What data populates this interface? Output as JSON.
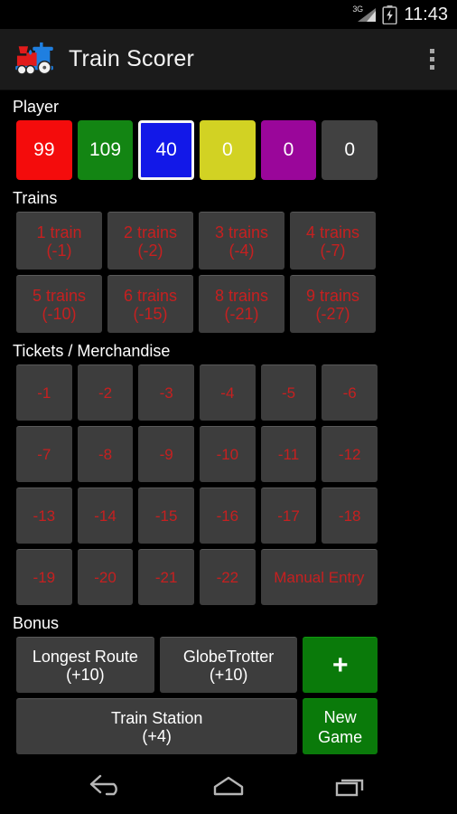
{
  "status_bar": {
    "network_label": "3G",
    "signal_icon": "signal-3g-icon",
    "battery_icon": "battery-charging-icon",
    "time": "11:43"
  },
  "action_bar": {
    "app_icon": "train-logo-icon",
    "title": "Train Scorer",
    "overflow_icon": "overflow-menu-icon"
  },
  "sections": {
    "player": {
      "label": "Player",
      "players": [
        {
          "score": "99",
          "color": "#f40c0c",
          "selected": false
        },
        {
          "score": "109",
          "color": "#138513",
          "selected": false
        },
        {
          "score": "40",
          "color": "#1218e8",
          "selected": true
        },
        {
          "score": "0",
          "color": "#d2d223",
          "selected": false
        },
        {
          "score": "0",
          "color": "#9a069a",
          "selected": false
        },
        {
          "score": "0",
          "color": "#414141",
          "selected": false
        }
      ]
    },
    "trains": {
      "label": "Trains",
      "buttons": [
        {
          "name": "1 train",
          "points": "(-1)"
        },
        {
          "name": "2 trains",
          "points": "(-2)"
        },
        {
          "name": "3 trains",
          "points": "(-4)"
        },
        {
          "name": "4 trains",
          "points": "(-7)"
        },
        {
          "name": "5 trains",
          "points": "(-10)"
        },
        {
          "name": "6 trains",
          "points": "(-15)"
        },
        {
          "name": "8 trains",
          "points": "(-21)"
        },
        {
          "name": "9 trains",
          "points": "(-27)"
        }
      ]
    },
    "tickets": {
      "label": "Tickets / Merchandise",
      "values": [
        "-1",
        "-2",
        "-3",
        "-4",
        "-5",
        "-6",
        "-7",
        "-8",
        "-9",
        "-10",
        "-11",
        "-12",
        "-13",
        "-14",
        "-15",
        "-16",
        "-17",
        "-18",
        "-19",
        "-20",
        "-21",
        "-22"
      ],
      "manual_entry": "Manual Entry"
    },
    "bonus": {
      "label": "Bonus",
      "longest_route": {
        "name": "Longest Route",
        "points": "(+10)"
      },
      "globetrotter": {
        "name": "GlobeTrotter",
        "points": "(+10)"
      },
      "train_station": {
        "name": "Train Station",
        "points": "(+4)"
      },
      "plus_label": "+",
      "new_game": {
        "line1": "New",
        "line2": "Game"
      },
      "green_color": "#0a7a0a"
    }
  },
  "nav_bar": {
    "back_icon": "back-arrow-icon",
    "home_icon": "home-icon",
    "recents_icon": "recent-apps-icon"
  }
}
